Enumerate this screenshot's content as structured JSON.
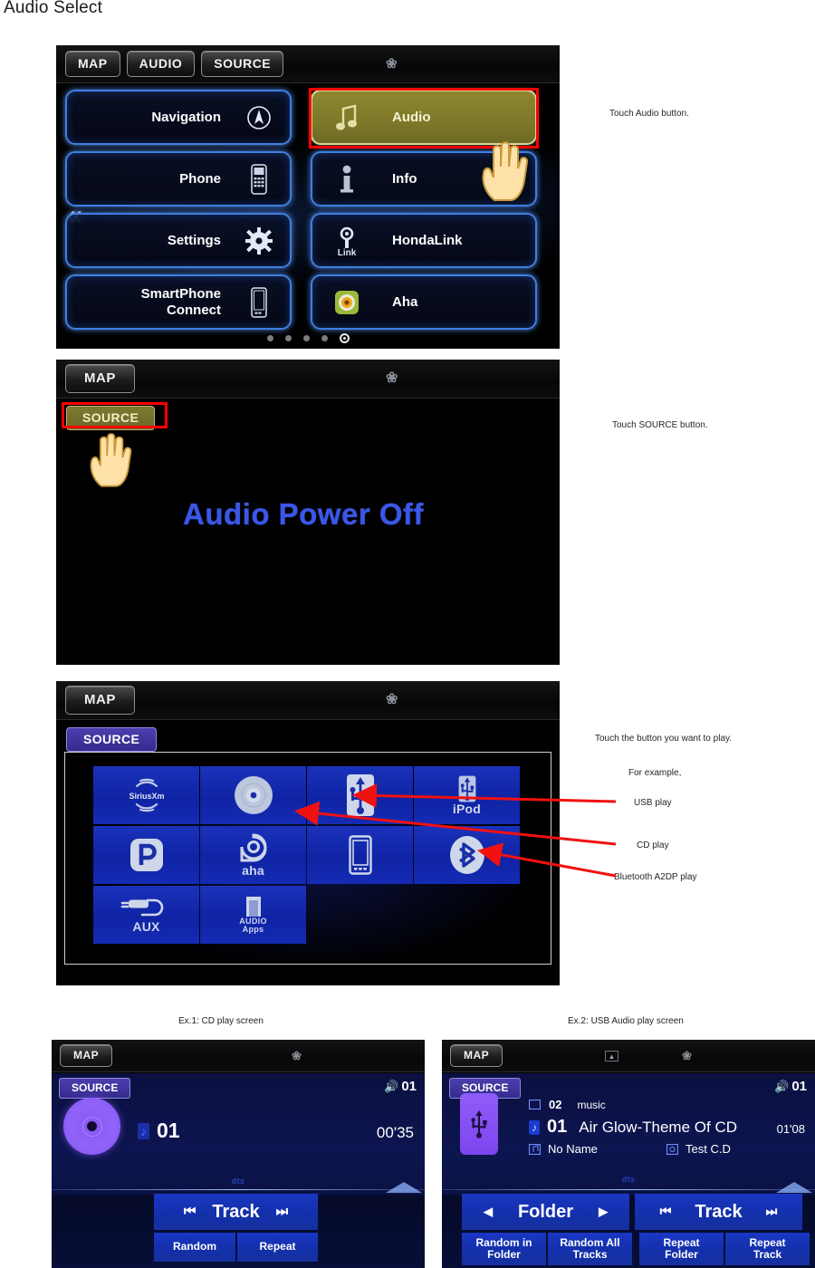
{
  "document": {
    "title": "Audio Select"
  },
  "screen1": {
    "name": "main-menu-screen",
    "statusbar": {
      "buttons": [
        "MAP",
        "AUDIO",
        "SOURCE"
      ],
      "bluetooth_icon": "bluetooth-icon"
    },
    "menu_left": [
      {
        "label": "Navigation",
        "icon": "compass-icon"
      },
      {
        "label": "Phone",
        "icon": "cellphone-icon"
      },
      {
        "label": "Settings",
        "icon": "gear-icon"
      },
      {
        "label": "SmartPhone\nConnect",
        "icon": "smartphone-icon"
      }
    ],
    "menu_right": [
      {
        "label": "Audio",
        "icon": "music-note-icon",
        "selected": true
      },
      {
        "label": "Info",
        "icon": "info-icon"
      },
      {
        "label": "HondaLink",
        "icon": "link-icon"
      },
      {
        "label": "Aha",
        "icon": "aha-icon"
      }
    ],
    "back_arrow": "«",
    "page_dots": {
      "count": 5,
      "current": 5
    },
    "highlight_color": "#ff0000",
    "selected_fill": "#8d8731"
  },
  "screen2": {
    "name": "audio-power-off-screen",
    "statusbar": {
      "buttons": [
        "MAP"
      ],
      "bluetooth_icon": "bluetooth-icon"
    },
    "source_button": "SOURCE",
    "message": "Audio Power Off",
    "message_color": "#3b57e8",
    "highlight_color": "#ff0000"
  },
  "screen3": {
    "name": "source-select-screen",
    "statusbar": {
      "buttons": [
        "MAP"
      ],
      "bluetooth_icon": "bluetooth-icon"
    },
    "source_button": "SOURCE",
    "tiles": [
      {
        "label": "SiriusXM",
        "icon": "siriusxm-icon",
        "label_style": "small"
      },
      {
        "label": "",
        "icon": "cd-disc-icon"
      },
      {
        "label": "",
        "icon": "usb-icon"
      },
      {
        "label": "iPod",
        "icon": "usb-icon"
      },
      {
        "label": "",
        "icon": "pandora-icon"
      },
      {
        "label": "aha",
        "icon": "aha-icon"
      },
      {
        "label": "",
        "icon": "smartphone-icon"
      },
      {
        "label": "",
        "icon": "bluetooth-icon"
      },
      {
        "label": "AUX",
        "icon": "aux-plug-icon"
      },
      {
        "label": "AUDIO\nApps",
        "icon": "audio-apps-icon",
        "label_style": "small"
      }
    ]
  },
  "annotations": [
    {
      "id": "note-audio",
      "text": "Touch Audio button."
    },
    {
      "id": "note-source",
      "text": "Touch SOURCE button."
    },
    {
      "id": "note-play",
      "text": "Touch the button you want to play."
    },
    {
      "id": "note-example",
      "text": "For example,"
    },
    {
      "id": "note-usb",
      "text": "USB play"
    },
    {
      "id": "note-cd",
      "text": "CD play"
    },
    {
      "id": "note-bt",
      "text": "Bluetooth A2DP play"
    }
  ],
  "example_cd": {
    "caption": "Ex.1: CD play screen",
    "statusbar": {
      "buttons": [
        "MAP"
      ],
      "bluetooth_icon": "bluetooth-icon"
    },
    "source_button": "SOURCE",
    "volume": "01",
    "track_number": "01",
    "elapsed": "00'35",
    "dts_logo": "dts",
    "controls": {
      "track_label": "Track",
      "prev_icon": "skip-previous-icon",
      "next_icon": "skip-next-icon",
      "random": "Random",
      "repeat": "Repeat"
    }
  },
  "example_usb": {
    "caption": "Ex.2: USB Audio play screen",
    "statusbar": {
      "buttons": [
        "MAP"
      ],
      "album_art_icon": "album-art-icon",
      "bluetooth_icon": "bluetooth-icon"
    },
    "source_button": "SOURCE",
    "volume": "01",
    "folder_number": "02",
    "folder_name": "music",
    "track_number": "01",
    "track_title": "Air Glow-Theme Of CD",
    "elapsed": "01'08",
    "artist": "No Name",
    "album": "Test C.D",
    "dts_logo": "dts",
    "controls": {
      "folder_label": "Folder",
      "folder_prev_icon": "triangle-left-icon",
      "folder_next_icon": "triangle-right-icon",
      "track_label": "Track",
      "prev_icon": "skip-previous-icon",
      "next_icon": "skip-next-icon",
      "random_in_folder": "Random in\nFolder",
      "random_all_tracks": "Random All\nTracks",
      "repeat_folder": "Repeat\nFolder",
      "repeat_track": "Repeat\nTrack"
    }
  }
}
